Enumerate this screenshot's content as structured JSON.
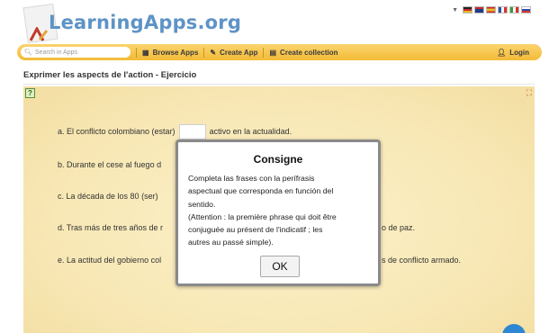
{
  "header": {
    "logo_text": "LearningApps.org",
    "languages": [
      {
        "name": "German",
        "color": "#d7a321"
      },
      {
        "name": "English",
        "color": "#3c4f96"
      },
      {
        "name": "Spanish",
        "color": "#d8352b"
      },
      {
        "name": "French",
        "color": "#2f54a6"
      },
      {
        "name": "Italian",
        "color": "#3d9a3a"
      },
      {
        "name": "Russian",
        "color": "#2d4aa8"
      }
    ]
  },
  "nav": {
    "search_placeholder": "Search in Apps",
    "browse": "Browse Apps",
    "create": "Create App",
    "collection": "Create collection",
    "login": "Login"
  },
  "page": {
    "title": "Exprimer les aspects de l'action - Ejercicio"
  },
  "exercise": {
    "q_a_before": "a. El conflicto colombiano (estar)",
    "q_a_after": "activo en la actualidad.",
    "q_b": "b. Durante el cese al fuego d",
    "q_c": "c. La década de los 80 (ser)",
    "q_d_left": "d. Tras más de tres años de r",
    "q_d_right": "o de paz.",
    "q_e_left": "e. La actitud del gobierno col",
    "q_e_right": "s de conflicto armado."
  },
  "modal": {
    "title": "Consigne",
    "body": "Completa las frases con la perífrasis\naspectual que corresponda en función del\nsentido.\n(Attention : la première phrase qui doit être\nconjuguée au présent de l'indicatif ; les\nautres au passé simple).",
    "ok_label": "OK"
  },
  "colors": {
    "nav_bar": "#f5c24a",
    "logo_text": "#5e93c6",
    "exercise_bg": "#f8e8b6",
    "fab": "#2f86d1"
  }
}
